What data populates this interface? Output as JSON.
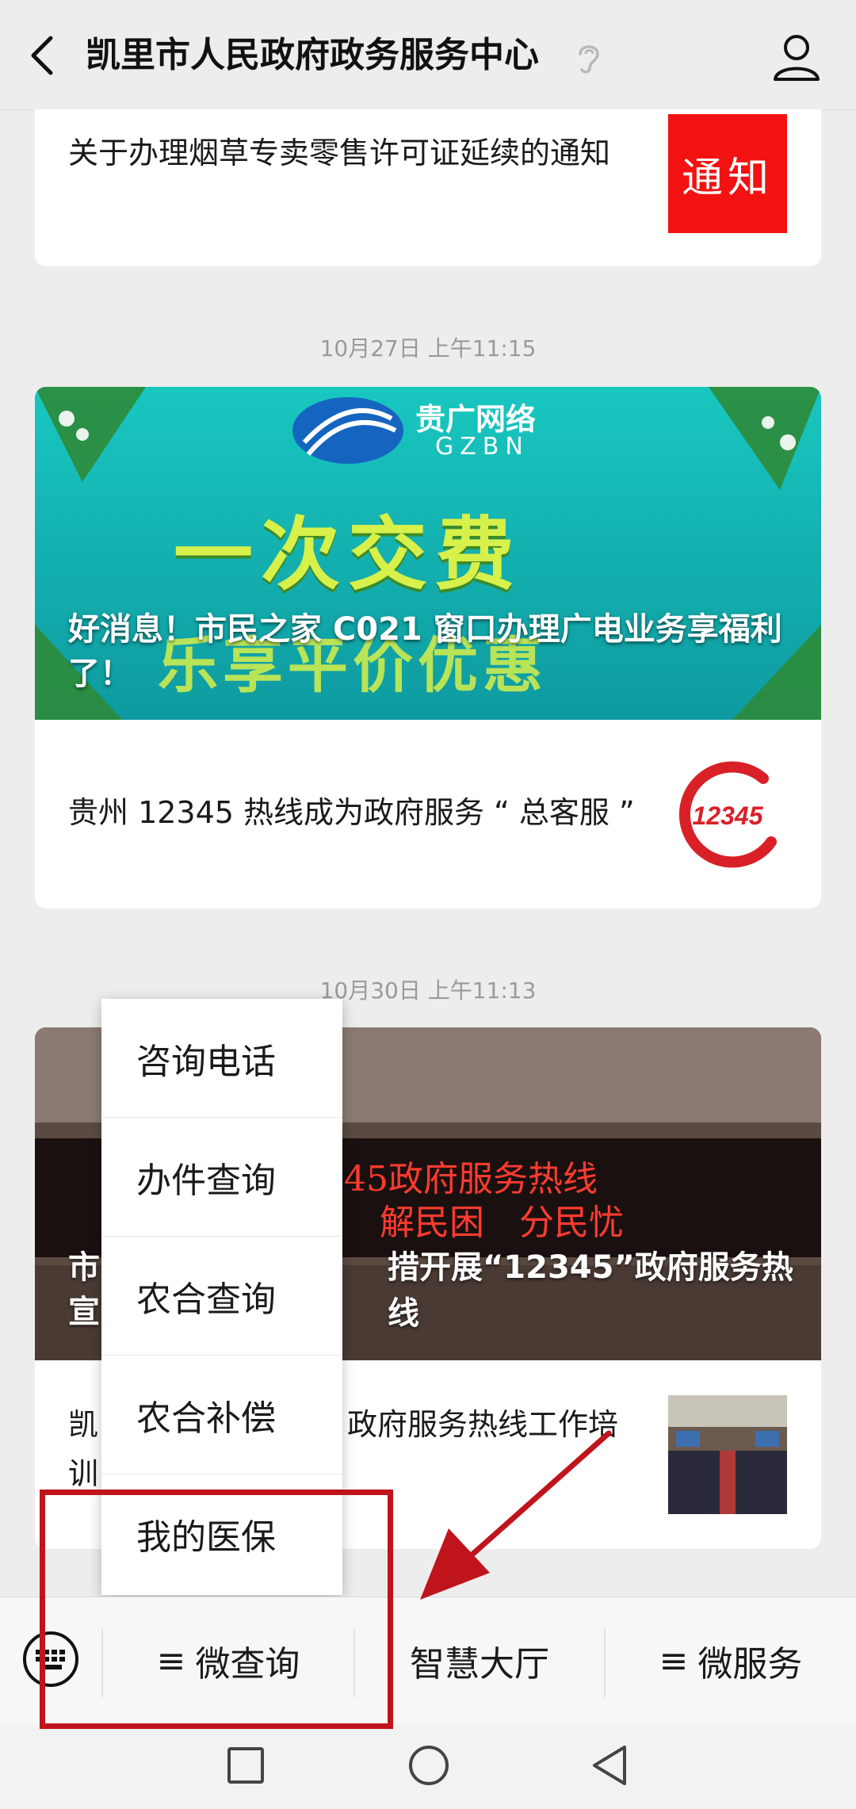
{
  "header": {
    "title": "凯里市人民政府政务服务中心"
  },
  "messages": [
    {
      "id": "notice",
      "text": "关于办理烟草专卖零售许可证延续的通知",
      "thumb_text": "通知"
    }
  ],
  "time1": "10月27日 上午11:15",
  "group1": {
    "banner_logo_cn": "贵广网络",
    "banner_logo_en": "GZBN",
    "banner_big": "一次交费",
    "banner_big2": "乐享平价优惠",
    "banner_title": "好消息！市民之家 C021 窗口办理广电业务享福利了！",
    "row_text": "贵州 12345 热线成为政府服务 “ 总客服 ”",
    "row_logo": "12345"
  },
  "time2": "10月30日 上午11:13",
  "group2": {
    "banner_led1": "45政府服务热线",
    "banner_led2": "解民困　分民忧",
    "banner_title_visible": "市",
    "banner_title_visible2": "措开展“12345”政府服务热线",
    "banner_title_line2": "宣",
    "row_text_a": "凯",
    "row_text_b": "政府服务热线工作培",
    "row_text_c": "训"
  },
  "popup_menu": {
    "items": [
      "咨询电话",
      "办件查询",
      "农合查询",
      "农合补偿",
      "我的医保"
    ]
  },
  "bottom_nav": {
    "items": [
      {
        "label": "微查询",
        "prefix": "≡"
      },
      {
        "label": "智慧大厅",
        "prefix": ""
      },
      {
        "label": "微服务",
        "prefix": "≡"
      }
    ]
  },
  "colors": {
    "highlight": "#c0141c",
    "notice_red": "#f21212"
  }
}
